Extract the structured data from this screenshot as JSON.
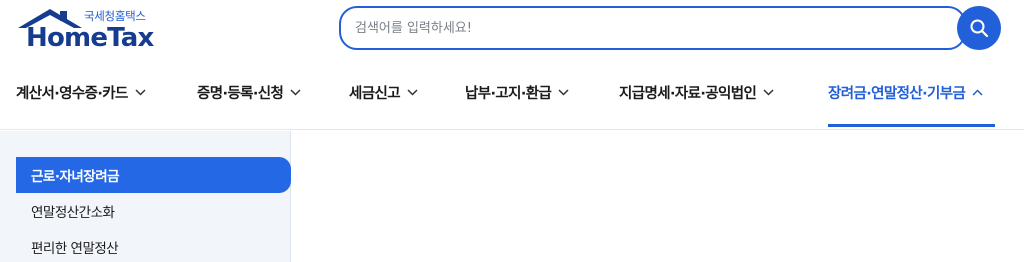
{
  "logo": {
    "sub": "국세청홈택스",
    "word": "HomeTax"
  },
  "search": {
    "placeholder": "검색어를 입력하세요!"
  },
  "nav": {
    "items": [
      {
        "label": "계산서·영수증·카드"
      },
      {
        "label": "증명·등록·신청"
      },
      {
        "label": "세금신고"
      },
      {
        "label": "납부·고지·환급"
      },
      {
        "label": "지급명세·자료·공익법인"
      },
      {
        "label": "장려금·연말정산·기부금",
        "active": true
      }
    ]
  },
  "sidebar": {
    "items": [
      {
        "label": "근로·자녀장려금",
        "active": true
      },
      {
        "label": "연말정산간소화"
      },
      {
        "label": "편리한 연말정산"
      }
    ]
  },
  "colors": {
    "accent": "#2160d8",
    "logo_text": "#163c8f",
    "sidebar_bg": "#f2f5fa"
  }
}
